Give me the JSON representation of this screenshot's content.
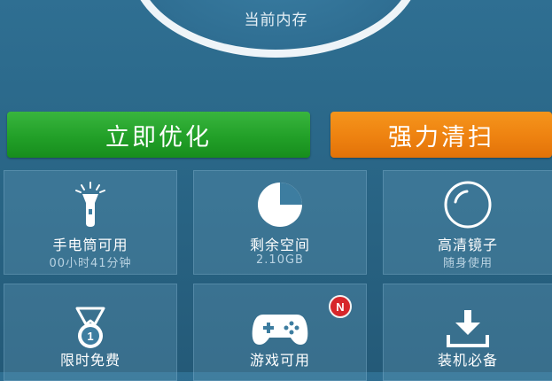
{
  "gauge": {
    "label": "当前内存"
  },
  "actions": {
    "optimize_label": "立即优化",
    "clean_label": "强力清扫"
  },
  "tiles": [
    {
      "title": "手电筒可用",
      "sub": "00小时41分钟",
      "icon": "flashlight-icon"
    },
    {
      "title": "剩余空间",
      "sub": "2.10GB",
      "icon": "storage-pie-icon"
    },
    {
      "title": "高清镜子",
      "sub": "随身使用",
      "icon": "mirror-icon"
    },
    {
      "title": "限时免费",
      "sub": "",
      "icon": "medal-icon"
    },
    {
      "title": "游戏可用",
      "sub": "",
      "icon": "gamepad-icon",
      "badge": "N"
    },
    {
      "title": "装机必备",
      "sub": "",
      "icon": "download-icon"
    }
  ],
  "colors": {
    "background": "#2a6788",
    "green_button": "#22a028",
    "orange_button": "#ee8210",
    "badge_red": "#d7262a"
  }
}
